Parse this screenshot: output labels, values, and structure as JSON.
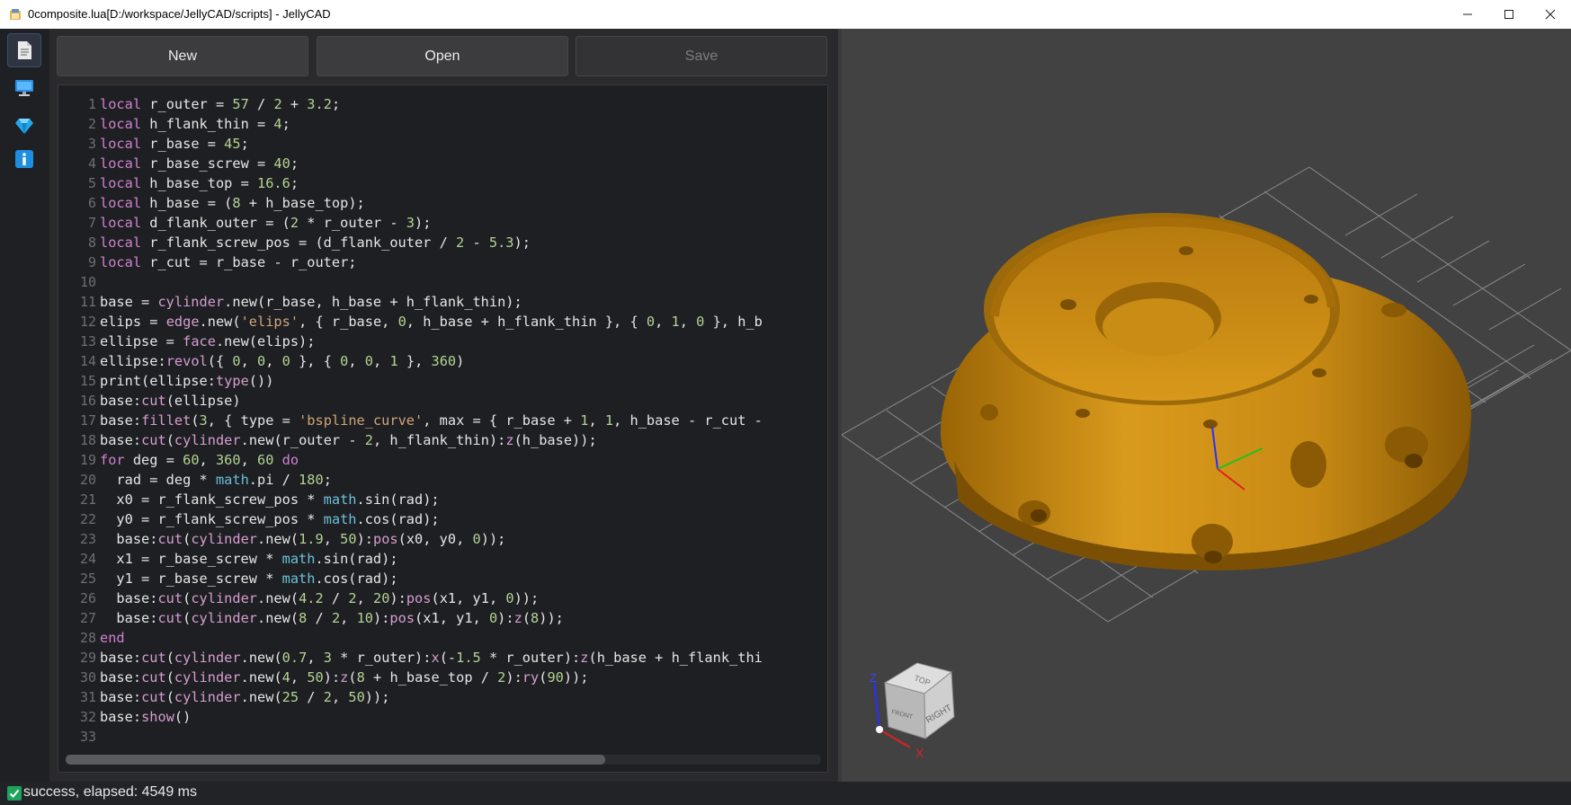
{
  "window": {
    "title": "0composite.lua[D:/workspace/JellyCAD/scripts] - JellyCAD"
  },
  "sidebar": {
    "items": [
      {
        "icon": "document-icon",
        "active": true
      },
      {
        "icon": "monitor-icon",
        "active": false
      },
      {
        "icon": "gem-icon",
        "active": false
      },
      {
        "icon": "info-icon",
        "active": false
      }
    ]
  },
  "toolbar": {
    "new_label": "New",
    "open_label": "Open",
    "save_label": "Save"
  },
  "editor": {
    "line_numbers": [
      "1",
      "2",
      "3",
      "4",
      "5",
      "6",
      "7",
      "8",
      "9",
      "10",
      "11",
      "12",
      "13",
      "14",
      "15",
      "16",
      "17",
      "18",
      "19",
      "20",
      "21",
      "22",
      "23",
      "24",
      "25",
      "26",
      "27",
      "28",
      "29",
      "30",
      "31",
      "32",
      "33"
    ],
    "lines": [
      "local r_outer = 57 / 2 + 3.2;",
      "local h_flank_thin = 4;",
      "local r_base = 45;",
      "local r_base_screw = 40;",
      "local h_base_top = 16.6;",
      "local h_base = (8 + h_base_top);",
      "local d_flank_outer = (2 * r_outer - 3);",
      "local r_flank_screw_pos = (d_flank_outer / 2 - 5.3);",
      "local r_cut = r_base - r_outer;",
      "",
      "base = cylinder.new(r_base, h_base + h_flank_thin);",
      "elips = edge.new('elips', { r_base, 0, h_base + h_flank_thin }, { 0, 1, 0 }, h_b",
      "ellipse = face.new(elips);",
      "ellipse:revol({ 0, 0, 0 }, { 0, 0, 1 }, 360)",
      "print(ellipse:type())",
      "base:cut(ellipse)",
      "base:fillet(3, { type = 'bspline_curve', max = { r_base + 1, 1, h_base - r_cut -",
      "base:cut(cylinder.new(r_outer - 2, h_flank_thin):z(h_base));",
      "for deg = 60, 360, 60 do",
      "  rad = deg * math.pi / 180;",
      "  x0 = r_flank_screw_pos * math.sin(rad);",
      "  y0 = r_flank_screw_pos * math.cos(rad);",
      "  base:cut(cylinder.new(1.9, 50):pos(x0, y0, 0));",
      "  x1 = r_base_screw * math.sin(rad);",
      "  y1 = r_base_screw * math.cos(rad);",
      "  base:cut(cylinder.new(4.2 / 2, 20):pos(x1, y1, 0));",
      "  base:cut(cylinder.new(8 / 2, 10):pos(x1, y1, 0):z(8));",
      "end",
      "base:cut(cylinder.new(0.7, 3 * r_outer):x(-1.5 * r_outer):z(h_base + h_flank_thi",
      "base:cut(cylinder.new(4, 50):z(8 + h_base_top / 2):ry(90));",
      "base:cut(cylinder.new(25 / 2, 50));",
      "base:show()",
      ""
    ]
  },
  "viewport": {
    "model_color": "#c88a14",
    "axes": {
      "x_label": "X",
      "z_label": "Z"
    },
    "view_cube": {
      "top_label": "TOP",
      "right_label": "RIGHT",
      "front_label": "FRONT"
    }
  },
  "status": {
    "text": "success, elapsed: 4549 ms"
  }
}
